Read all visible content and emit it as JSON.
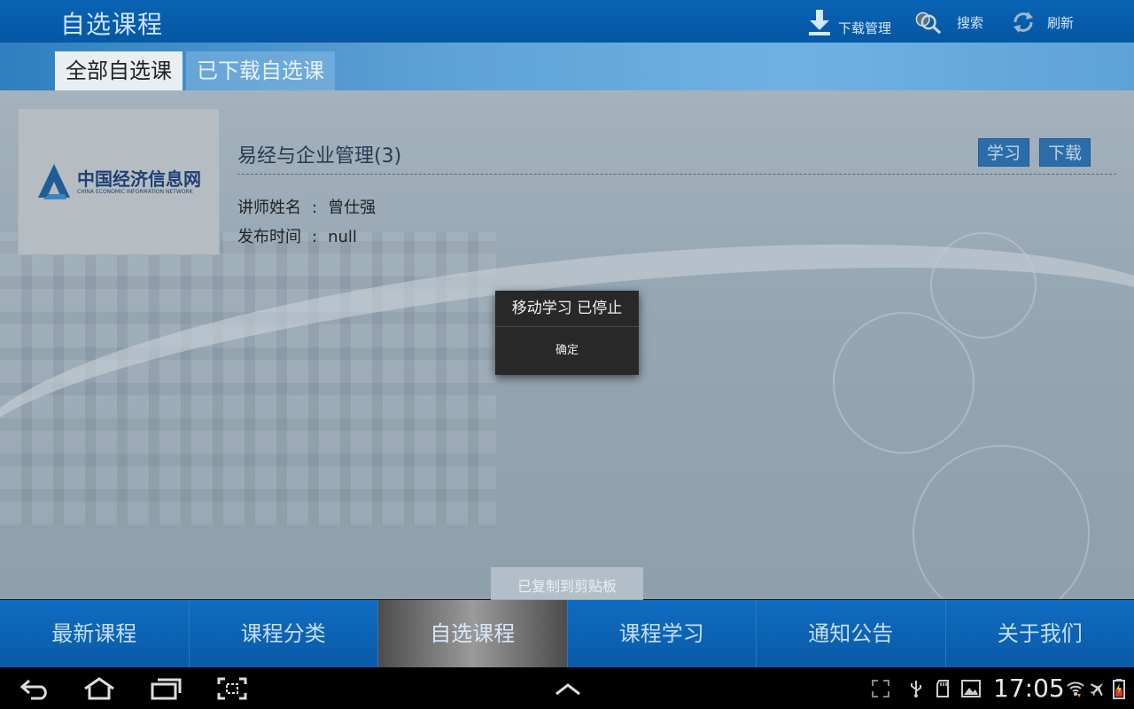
{
  "header": {
    "title": "自选课程",
    "actions": [
      {
        "label": "下载管理",
        "icon": "download-icon"
      },
      {
        "label": "搜索",
        "icon": "search-icon"
      },
      {
        "label": "刷新",
        "icon": "refresh-icon"
      }
    ]
  },
  "tabs": [
    {
      "label": "全部自选课",
      "active": true
    },
    {
      "label": "已下载自选课",
      "active": false
    }
  ],
  "course": {
    "logo_cn": "中国经济信息网",
    "logo_en": "CHINA ECONOMIC INFORMATION NETWORK",
    "title": "易经与企业管理(3)",
    "study_label": "学习",
    "download_label": "下载",
    "teacher_label": "讲师姓名",
    "teacher_value": "曾仕强",
    "date_label": "发布时间",
    "date_value": "null",
    "separator": ":"
  },
  "dialog": {
    "title": "移动学习 已停止",
    "ok_label": "确定"
  },
  "toast": "已复制到剪贴板",
  "bottom_nav": [
    {
      "label": "最新课程",
      "active": false
    },
    {
      "label": "课程分类",
      "active": false
    },
    {
      "label": "自选课程",
      "active": true
    },
    {
      "label": "课程学习",
      "active": false
    },
    {
      "label": "通知公告",
      "active": false
    },
    {
      "label": "关于我们",
      "active": false
    }
  ],
  "system_bar": {
    "time": "17:05",
    "nav_icons": [
      "back-icon",
      "home-icon",
      "recent-apps-icon",
      "screenshot-icon",
      "menu-up-icon"
    ],
    "status_icons": [
      "fullscreen-icon",
      "usb-icon",
      "sd-card-icon",
      "gallery-icon",
      "wifi-icon",
      "airplane-icon",
      "battery-icon"
    ]
  },
  "colors": {
    "header_blue": "#0a63b4",
    "nav_blue": "#0f6cc0",
    "button_blue": "#2a72b8",
    "dialog_bg": "#282828"
  }
}
